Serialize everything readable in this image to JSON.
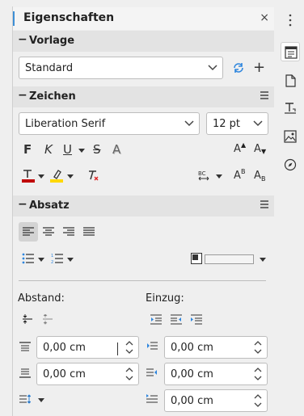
{
  "panel": {
    "title": "Eigenschaften",
    "close_glyph": "×"
  },
  "sections": {
    "vorlage": {
      "title": "Vorlage",
      "style_value": "Standard",
      "new_glyph": "+"
    },
    "zeichen": {
      "title": "Zeichen",
      "font_name": "Liberation Serif",
      "font_size": "12 pt",
      "bold": "F",
      "italic": "K",
      "underline": "U",
      "strike": "S",
      "shadow": "A",
      "grow": "A",
      "shrink": "A",
      "super": "A",
      "sub": "A"
    },
    "absatz": {
      "title": "Absatz",
      "spacing_label": "Abstand:",
      "indent_label": "Einzug:",
      "above_value": "0,00 cm",
      "below_value": "0,00 cm",
      "before_indent_value": "0,00 cm",
      "after_indent_value": "0,00 cm",
      "first_line_value": "0,00 cm"
    }
  },
  "colors": {
    "accent": "#3d8fd6",
    "font_color": "#c00000",
    "highlight_color": "#ffd800",
    "refresh": "#2e86de"
  },
  "tabbar": {
    "items": [
      "properties-icon",
      "page-icon",
      "styles-icon",
      "gallery-icon",
      "navigator-icon"
    ]
  }
}
